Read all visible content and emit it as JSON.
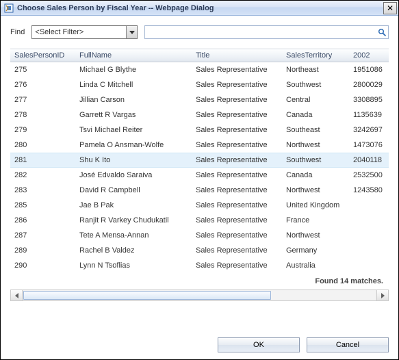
{
  "window": {
    "title": "Choose Sales Person by Fiscal Year -- Webpage Dialog",
    "close_glyph": "✕"
  },
  "find": {
    "label": "Find",
    "filter_selected": "<Select Filter>",
    "search_value": ""
  },
  "grid": {
    "columns": {
      "id": "SalesPersonID",
      "name": "FullName",
      "title": "Title",
      "terr": "SalesTerritory",
      "y2002": "2002"
    },
    "rows": [
      {
        "id": "275",
        "name": "Michael G Blythe",
        "title": "Sales Representative",
        "terr": "Northeast",
        "y2002": "1951086"
      },
      {
        "id": "276",
        "name": "Linda C Mitchell",
        "title": "Sales Representative",
        "terr": "Southwest",
        "y2002": "2800029"
      },
      {
        "id": "277",
        "name": "Jillian Carson",
        "title": "Sales Representative",
        "terr": "Central",
        "y2002": "3308895"
      },
      {
        "id": "278",
        "name": "Garrett R Vargas",
        "title": "Sales Representative",
        "terr": "Canada",
        "y2002": "1135639"
      },
      {
        "id": "279",
        "name": "Tsvi Michael Reiter",
        "title": "Sales Representative",
        "terr": "Southeast",
        "y2002": "3242697"
      },
      {
        "id": "280",
        "name": "Pamela O Ansman-Wolfe",
        "title": "Sales Representative",
        "terr": "Northwest",
        "y2002": "1473076"
      },
      {
        "id": "281",
        "name": "Shu K Ito",
        "title": "Sales Representative",
        "terr": "Southwest",
        "y2002": "2040118"
      },
      {
        "id": "282",
        "name": "José Edvaldo Saraiva",
        "title": "Sales Representative",
        "terr": "Canada",
        "y2002": "2532500"
      },
      {
        "id": "283",
        "name": "David R Campbell",
        "title": "Sales Representative",
        "terr": "Northwest",
        "y2002": "1243580"
      },
      {
        "id": "285",
        "name": "Jae B Pak",
        "title": "Sales Representative",
        "terr": "United Kingdom",
        "y2002": ""
      },
      {
        "id": "286",
        "name": "Ranjit R Varkey Chudukatil",
        "title": "Sales Representative",
        "terr": "France",
        "y2002": ""
      },
      {
        "id": "287",
        "name": "Tete A Mensa-Annan",
        "title": "Sales Representative",
        "terr": "Northwest",
        "y2002": ""
      },
      {
        "id": "289",
        "name": "Rachel B Valdez",
        "title": "Sales Representative",
        "terr": "Germany",
        "y2002": ""
      },
      {
        "id": "290",
        "name": "Lynn N Tsoflias",
        "title": "Sales Representative",
        "terr": "Australia",
        "y2002": ""
      }
    ],
    "selected_index": 6,
    "matches_text": "Found 14 matches."
  },
  "buttons": {
    "ok": "OK",
    "cancel": "Cancel"
  },
  "colors": {
    "selected_row": "#e4f1fb"
  }
}
